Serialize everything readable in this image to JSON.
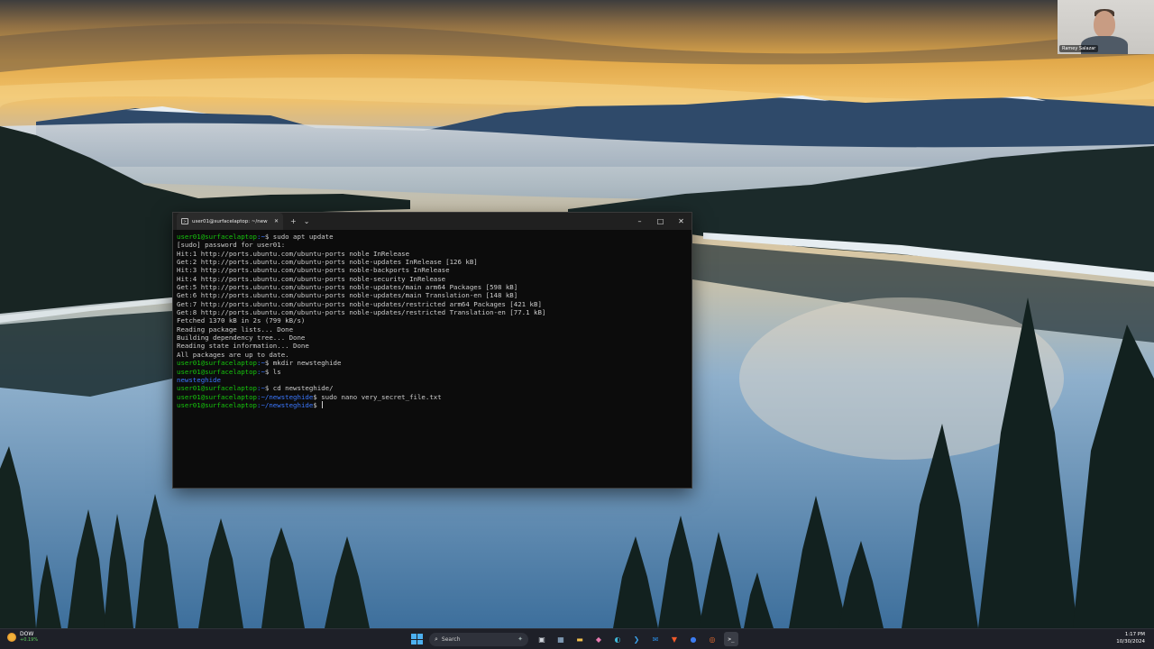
{
  "webcam": {
    "participant_name": "Ramey Salazar"
  },
  "terminal": {
    "tab_title": "user01@surfacelaptop: ~/new",
    "new_tab_glyph": "+",
    "dropdown_glyph": "⌄",
    "controls": {
      "minimize": "–",
      "maximize": "□",
      "close": "✕"
    },
    "prompt_user": "user01@surfacelaptop",
    "lines": {
      "l1_path": ":~",
      "l1_cmd": "$ sudo apt update",
      "l2": "[sudo] password for user01:",
      "l3": "Hit:1 http://ports.ubuntu.com/ubuntu-ports noble InRelease",
      "l4": "Get:2 http://ports.ubuntu.com/ubuntu-ports noble-updates InRelease [126 kB]",
      "l5": "Hit:3 http://ports.ubuntu.com/ubuntu-ports noble-backports InRelease",
      "l6": "Hit:4 http://ports.ubuntu.com/ubuntu-ports noble-security InRelease",
      "l7": "Get:5 http://ports.ubuntu.com/ubuntu-ports noble-updates/main arm64 Packages [598 kB]",
      "l8": "Get:6 http://ports.ubuntu.com/ubuntu-ports noble-updates/main Translation-en [148 kB]",
      "l9": "Get:7 http://ports.ubuntu.com/ubuntu-ports noble-updates/restricted arm64 Packages [421 kB]",
      "l10": "Get:8 http://ports.ubuntu.com/ubuntu-ports noble-updates/restricted Translation-en [77.1 kB]",
      "l11": "Fetched 1370 kB in 2s (799 kB/s)",
      "l12": "Reading package lists... Done",
      "l13": "Building dependency tree... Done",
      "l14": "Reading state information... Done",
      "l15": "All packages are up to date.",
      "l16_path": ":~",
      "l16_cmd": "$ mkdir newsteghide",
      "l17_path": ":~",
      "l17_cmd": "$ ls",
      "l18_dir": "newsteghide",
      "l19_path": ":~",
      "l19_cmd": "$ cd newsteghide/",
      "l20_path": ":~/newsteghide",
      "l20_cmd": "$ sudo nano very_secret_file.txt",
      "l21_path": ":~/newsteghide",
      "l21_cmd": "$ "
    }
  },
  "taskbar": {
    "weather_title": "DOW",
    "weather_sub": "+0.19%",
    "search_placeholder": "Search",
    "apps": [
      {
        "name": "task-view",
        "glyph": "▣"
      },
      {
        "name": "widgets",
        "glyph": "▦"
      },
      {
        "name": "file-explorer",
        "glyph": "▬"
      },
      {
        "name": "copilot",
        "glyph": "◆"
      },
      {
        "name": "edge",
        "glyph": "◐"
      },
      {
        "name": "vscode",
        "glyph": "❯"
      },
      {
        "name": "outlook",
        "glyph": "✉"
      },
      {
        "name": "brave",
        "glyph": "▼"
      },
      {
        "name": "messenger",
        "glyph": "●"
      },
      {
        "name": "ubuntu",
        "glyph": "◎"
      },
      {
        "name": "terminal",
        "glyph": ">_"
      }
    ],
    "time": "1:17 PM",
    "date": "10/30/2024"
  },
  "colors": {
    "accent": "#4cb0f0",
    "prompt_user": "#16c60c",
    "prompt_path": "#3b78ff"
  }
}
